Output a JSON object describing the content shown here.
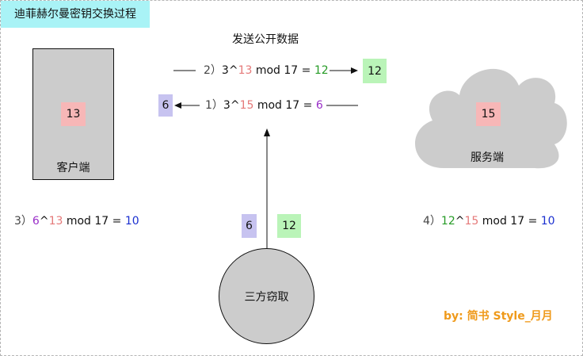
{
  "title": "迪菲赫尔曼密钥交换过程",
  "subtitle": "发送公开数据",
  "client": {
    "label": "客户端",
    "secret": "13"
  },
  "server": {
    "label": "服务端",
    "secret": "15"
  },
  "eavesdropper": {
    "label": "三方窃取",
    "captured_left": "6",
    "captured_right": "12"
  },
  "step2": {
    "num": "2）",
    "base": "3^",
    "exp": "13",
    "mid": " mod 17 = ",
    "result": "12",
    "public_value": "12"
  },
  "step1": {
    "num": "1）",
    "base": "3^",
    "exp": "15",
    "mid": " mod 17 = ",
    "result": "6",
    "public_value": "6"
  },
  "step3": {
    "num": "3）",
    "base": "6",
    "caret": "^",
    "exp": "13",
    "mid": " mod 17 = ",
    "result": "10"
  },
  "step4": {
    "num": "4）",
    "base": "12",
    "caret": "^",
    "exp": "15",
    "mid": " mod 17 = ",
    "result": "10"
  },
  "credit": "by: 简书 Style_月月",
  "colors": {
    "cyan_title": "#a9f3f6",
    "pink": "#f7b7b7",
    "green": "#baf4b8",
    "purple": "#c7c3f0",
    "grey": "#cccccc",
    "credit": "#ef9a1b"
  }
}
